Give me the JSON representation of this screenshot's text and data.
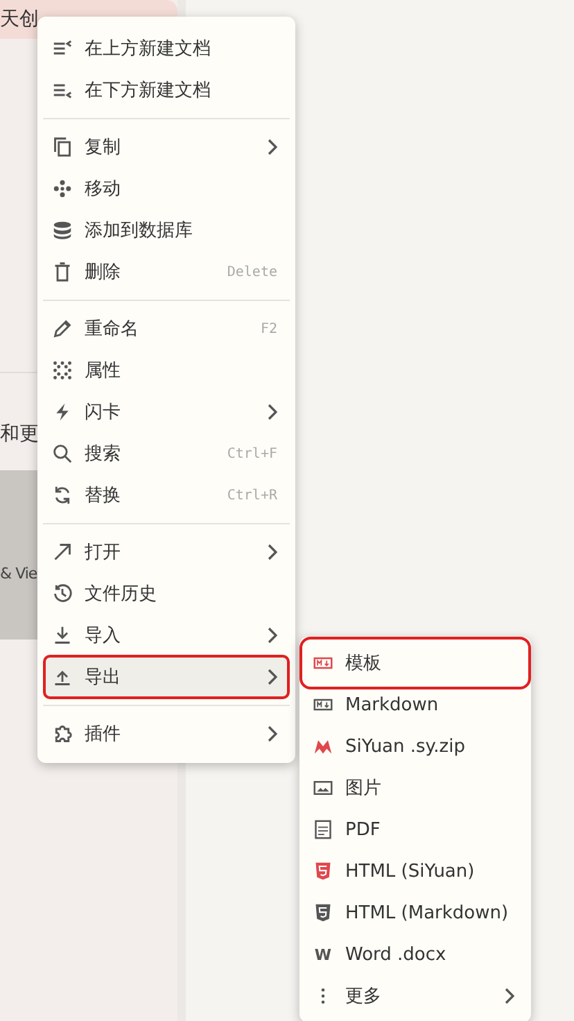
{
  "sidebar": {
    "items": [
      {
        "label": "天创",
        "selected": true
      },
      {
        "label": "和更",
        "selected": false
      },
      {
        "label": "& Vie",
        "selected": false
      }
    ]
  },
  "menu": {
    "groups": [
      [
        {
          "label": "在上方新建文档",
          "has_submenu": false,
          "selected": false,
          "outlined": false
        },
        {
          "label": "在下方新建文档",
          "has_submenu": false,
          "selected": false,
          "outlined": false
        }
      ],
      [
        {
          "label": "复制",
          "has_submenu": true,
          "selected": false,
          "outlined": false
        },
        {
          "label": "移动",
          "has_submenu": false,
          "selected": false,
          "outlined": false
        },
        {
          "label": "添加到数据库",
          "has_submenu": false,
          "selected": false,
          "outlined": false
        },
        {
          "label": "删除",
          "shortcut": "Delete",
          "has_submenu": false,
          "selected": false,
          "outlined": false
        }
      ],
      [
        {
          "label": "重命名",
          "shortcut": "F2",
          "has_submenu": false,
          "selected": false,
          "outlined": false
        },
        {
          "label": "属性",
          "has_submenu": false,
          "selected": false,
          "outlined": false
        },
        {
          "label": "闪卡",
          "has_submenu": true,
          "selected": false,
          "outlined": false
        },
        {
          "label": "搜索",
          "shortcut": "Ctrl+F",
          "has_submenu": false,
          "selected": false,
          "outlined": false
        },
        {
          "label": "替换",
          "shortcut": "Ctrl+R",
          "has_submenu": false,
          "selected": false,
          "outlined": false
        }
      ],
      [
        {
          "label": "打开",
          "has_submenu": true,
          "selected": false,
          "outlined": false
        },
        {
          "label": "文件历史",
          "has_submenu": false,
          "selected": false,
          "outlined": false
        },
        {
          "label": "导入",
          "has_submenu": true,
          "selected": false,
          "outlined": false
        },
        {
          "label": "导出",
          "has_submenu": true,
          "selected": true,
          "outlined": true
        }
      ],
      [
        {
          "label": "插件",
          "has_submenu": true,
          "selected": false,
          "outlined": false
        }
      ]
    ]
  },
  "submenu": {
    "items": [
      {
        "label": "模板",
        "has_submenu": false,
        "outlined": true
      },
      {
        "label": "Markdown",
        "has_submenu": false,
        "outlined": false
      },
      {
        "label": "SiYuan .sy.zip",
        "has_submenu": false,
        "outlined": false
      },
      {
        "label": "图片",
        "has_submenu": false,
        "outlined": false
      },
      {
        "label": "PDF",
        "has_submenu": false,
        "outlined": false
      },
      {
        "label": "HTML (SiYuan)",
        "has_submenu": false,
        "outlined": false
      },
      {
        "label": "HTML (Markdown)",
        "has_submenu": false,
        "outlined": false
      },
      {
        "label": "Word .docx",
        "icon_text": "W",
        "has_submenu": false,
        "outlined": false
      },
      {
        "label": "更多",
        "has_submenu": true,
        "outlined": false
      }
    ]
  }
}
